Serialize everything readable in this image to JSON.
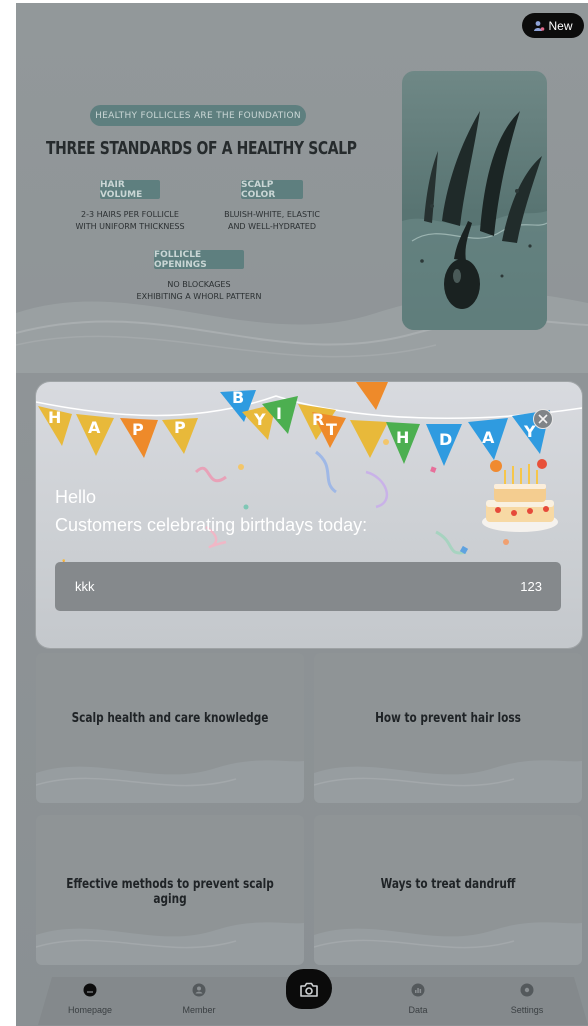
{
  "badge": {
    "label": "New"
  },
  "hero": {
    "pill": "HEALTHY FOLLICLES ARE THE FOUNDATION",
    "title": "THREE STANDARDS OF A HEALTHY SCALP",
    "standards": [
      {
        "tag": "HAIR VOLUME",
        "line1": "2-3 HAIRS PER FOLLICLE",
        "line2": "WITH UNIFORM THICKNESS"
      },
      {
        "tag": "SCALP COLOR",
        "line1": "BLUISH-WHITE, ELASTIC",
        "line2": "AND WELL-HYDRATED"
      },
      {
        "tag": "FOLLICLE OPENINGS",
        "line1": "NO BLOCKAGES",
        "line2": "EXHIBITING A WHORL PATTERN"
      }
    ]
  },
  "cards": [
    {
      "title": "Scalp health and care knowledge"
    },
    {
      "title": "How to prevent hair loss"
    },
    {
      "title": "Effective methods to prevent scalp aging"
    },
    {
      "title": "Ways to treat dandruff"
    }
  ],
  "nav": {
    "items": [
      {
        "label": "Homepage"
      },
      {
        "label": "Member"
      },
      {
        "label": "Data"
      },
      {
        "label": "Settings"
      }
    ]
  },
  "modal": {
    "banner_letters": [
      "H",
      "A",
      "P",
      "P",
      "Y",
      "B",
      "I",
      "R",
      "T",
      "H",
      "D",
      "A",
      "Y"
    ],
    "hello": "Hello",
    "subtitle": "Customers celebrating birthdays today:",
    "customers": [
      {
        "name": "kkk",
        "value": "123"
      }
    ]
  },
  "colors": {
    "overlay_gray": "#8f9497",
    "accent_teal": "#5e7f7f",
    "flag_yellow": "#f2c23a",
    "flag_orange": "#ee8a2a",
    "flag_blue": "#2f9be0",
    "flag_green": "#4caf50"
  }
}
